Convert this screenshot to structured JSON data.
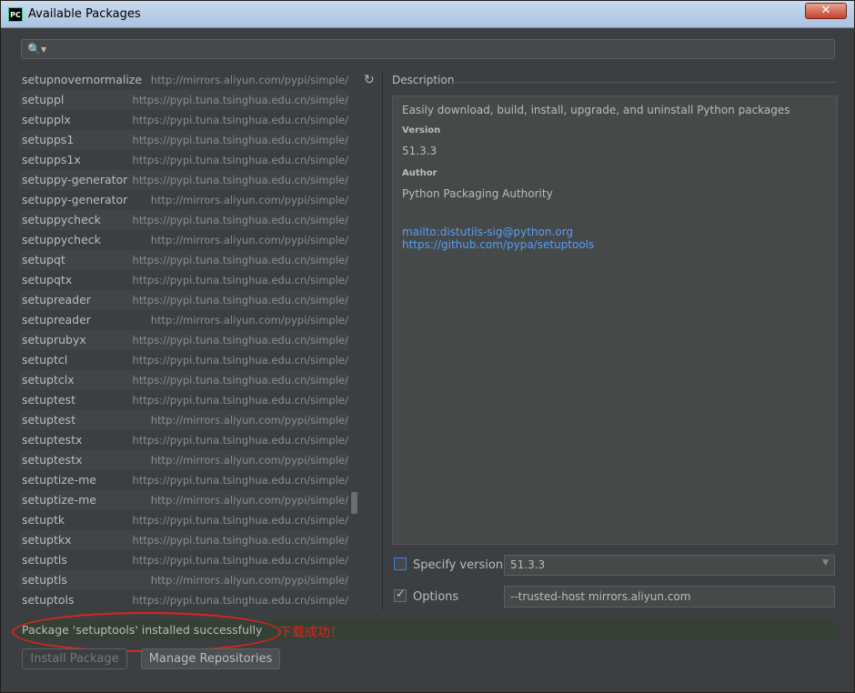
{
  "window": {
    "title": "Available Packages",
    "app_icon": "PC",
    "close_label": "✕"
  },
  "search": {
    "value": "",
    "placeholder": ""
  },
  "packages": [
    {
      "name": "setupnovernormalize",
      "repo": "http://mirrors.aliyun.com/pypi/simple/"
    },
    {
      "name": "setuppl",
      "repo": "https://pypi.tuna.tsinghua.edu.cn/simple/"
    },
    {
      "name": "setupplx",
      "repo": "https://pypi.tuna.tsinghua.edu.cn/simple/"
    },
    {
      "name": "setupps1",
      "repo": "https://pypi.tuna.tsinghua.edu.cn/simple/"
    },
    {
      "name": "setupps1x",
      "repo": "https://pypi.tuna.tsinghua.edu.cn/simple/"
    },
    {
      "name": "setuppy-generator",
      "repo": "https://pypi.tuna.tsinghua.edu.cn/simple/"
    },
    {
      "name": "setuppy-generator",
      "repo": "http://mirrors.aliyun.com/pypi/simple/"
    },
    {
      "name": "setuppycheck",
      "repo": "https://pypi.tuna.tsinghua.edu.cn/simple/"
    },
    {
      "name": "setuppycheck",
      "repo": "http://mirrors.aliyun.com/pypi/simple/"
    },
    {
      "name": "setupqt",
      "repo": "https://pypi.tuna.tsinghua.edu.cn/simple/"
    },
    {
      "name": "setupqtx",
      "repo": "https://pypi.tuna.tsinghua.edu.cn/simple/"
    },
    {
      "name": "setupreader",
      "repo": "https://pypi.tuna.tsinghua.edu.cn/simple/"
    },
    {
      "name": "setupreader",
      "repo": "http://mirrors.aliyun.com/pypi/simple/"
    },
    {
      "name": "setuprubyx",
      "repo": "https://pypi.tuna.tsinghua.edu.cn/simple/"
    },
    {
      "name": "setuptcl",
      "repo": "https://pypi.tuna.tsinghua.edu.cn/simple/"
    },
    {
      "name": "setuptclx",
      "repo": "https://pypi.tuna.tsinghua.edu.cn/simple/"
    },
    {
      "name": "setuptest",
      "repo": "https://pypi.tuna.tsinghua.edu.cn/simple/"
    },
    {
      "name": "setuptest",
      "repo": "http://mirrors.aliyun.com/pypi/simple/"
    },
    {
      "name": "setuptestx",
      "repo": "https://pypi.tuna.tsinghua.edu.cn/simple/"
    },
    {
      "name": "setuptestx",
      "repo": "http://mirrors.aliyun.com/pypi/simple/"
    },
    {
      "name": "setuptize-me",
      "repo": "https://pypi.tuna.tsinghua.edu.cn/simple/"
    },
    {
      "name": "setuptize-me",
      "repo": "http://mirrors.aliyun.com/pypi/simple/"
    },
    {
      "name": "setuptk",
      "repo": "https://pypi.tuna.tsinghua.edu.cn/simple/"
    },
    {
      "name": "setuptkx",
      "repo": "https://pypi.tuna.tsinghua.edu.cn/simple/"
    },
    {
      "name": "setuptls",
      "repo": "https://pypi.tuna.tsinghua.edu.cn/simple/"
    },
    {
      "name": "setuptls",
      "repo": "http://mirrors.aliyun.com/pypi/simple/"
    },
    {
      "name": "setuptols",
      "repo": "https://pypi.tuna.tsinghua.edu.cn/simple/"
    }
  ],
  "description": {
    "header": "Description",
    "summary": "Easily download, build, install, upgrade, and uninstall Python packages",
    "version_label": "Version",
    "version_value": "51.3.3",
    "author_label": "Author",
    "author_value": "Python Packaging Authority",
    "link_mail": "mailto:distutils-sig@python.org",
    "link_github": "https://github.com/pypa/setuptools"
  },
  "specify_version": {
    "label": "Specify version",
    "checked": false,
    "value": "51.3.3"
  },
  "options": {
    "label": "Options",
    "checked": true,
    "value": "--trusted-host mirrors.aliyun.com"
  },
  "status": {
    "message": "Package 'setuptools' installed successfully"
  },
  "annotation": {
    "text": "下载成功！"
  },
  "buttons": {
    "install": "Install Package",
    "manage": "Manage Repositories"
  },
  "icons": {
    "search": "search-icon",
    "refresh": "refresh-icon",
    "close": "close-icon",
    "dropdown": "chevron-down-icon"
  },
  "colors": {
    "link": "#589df6",
    "annotation": "#e0231b",
    "status_bg": "#344134"
  }
}
